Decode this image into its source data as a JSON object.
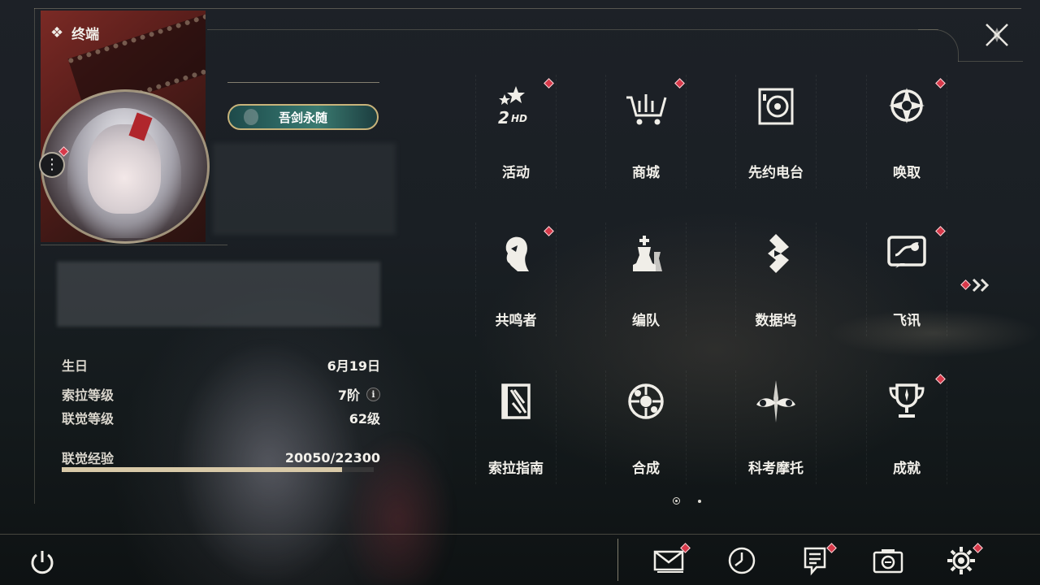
{
  "header": {
    "title": "终端"
  },
  "profile": {
    "title_badge": "吾剑永随",
    "stats": [
      {
        "label": "生日",
        "value": "6月19日"
      },
      {
        "label": "索拉等级",
        "value": "7阶"
      },
      {
        "label": "联觉等级",
        "value": "62级"
      }
    ],
    "exp": {
      "label": "联觉经验",
      "value": "20050/22300",
      "fraction": 0.899
    }
  },
  "grid": {
    "items": [
      {
        "label": "活动",
        "icon": "event-2hd-icon",
        "badge": true
      },
      {
        "label": "商城",
        "icon": "shop-cart-icon",
        "badge": true
      },
      {
        "label": "先约电台",
        "icon": "radio-icon",
        "badge": false
      },
      {
        "label": "唤取",
        "icon": "convene-compass-icon",
        "badge": true
      },
      {
        "label": "共鸣者",
        "icon": "resonator-head-icon",
        "badge": true
      },
      {
        "label": "编队",
        "icon": "team-chess-icon",
        "badge": false
      },
      {
        "label": "数据坞",
        "icon": "data-bank-icon",
        "badge": false
      },
      {
        "label": "飞讯",
        "icon": "message-chat-icon",
        "badge": true
      },
      {
        "label": "索拉指南",
        "icon": "guidebook-icon",
        "badge": false
      },
      {
        "label": "合成",
        "icon": "synthesis-icon",
        "badge": false
      },
      {
        "label": "科考摩托",
        "icon": "motorcycle-icon",
        "badge": false
      },
      {
        "label": "成就",
        "icon": "trophy-icon",
        "badge": true
      }
    ],
    "page_indicator": {
      "current": 1,
      "total": 2
    }
  },
  "bottom_bar": {
    "buttons": [
      {
        "icon": "mail-icon",
        "badge": true
      },
      {
        "icon": "clock-icon",
        "badge": false
      },
      {
        "icon": "notice-icon",
        "badge": true
      },
      {
        "icon": "camera-icon",
        "badge": false
      },
      {
        "icon": "settings-gear-icon",
        "badge": true
      }
    ]
  },
  "colors": {
    "badge_red": "#d8394a",
    "accent_gold": "#c8b37a",
    "exp_fill": "#d8c9a8"
  }
}
